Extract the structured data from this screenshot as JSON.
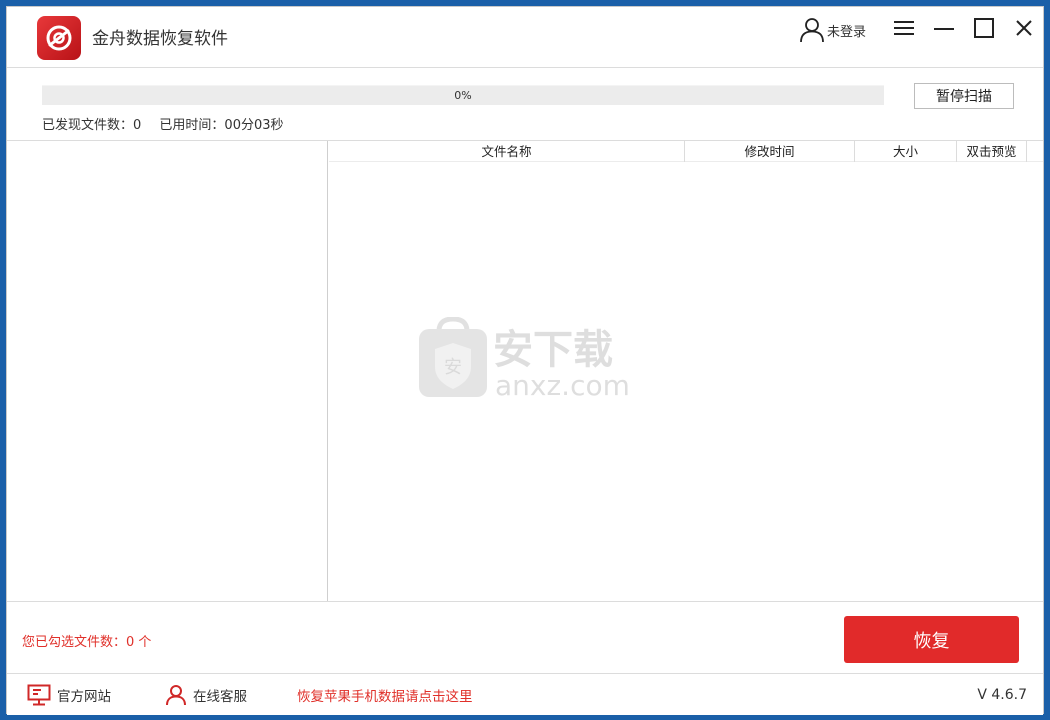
{
  "app": {
    "title": "金舟数据恢复软件",
    "user_label": "未登录"
  },
  "scan": {
    "progress_percent": 0,
    "progress_label": "0%",
    "pause_label": "暂停扫描",
    "found_files": "已发现文件数：0",
    "elapsed_time": "已用时间：00分03秒"
  },
  "file_list": {
    "columns": [
      "文件名称",
      "修改时间",
      "大小",
      "双击预览"
    ]
  },
  "watermark": {
    "cn_text": "安下载",
    "url_text": "anxz.com",
    "shield_char": "安"
  },
  "selection": {
    "count_text": "您已勾选文件数：0 个"
  },
  "actions": {
    "recover_label": "恢复"
  },
  "footer": {
    "website_label": "官方网站",
    "support_label": "在线客服",
    "iphone_recovery_label": "恢复苹果手机数据请点击这里",
    "version": "V 4.6.7"
  },
  "colors": {
    "accent": "#e12a2a",
    "desktop": "#1a5fa8"
  }
}
